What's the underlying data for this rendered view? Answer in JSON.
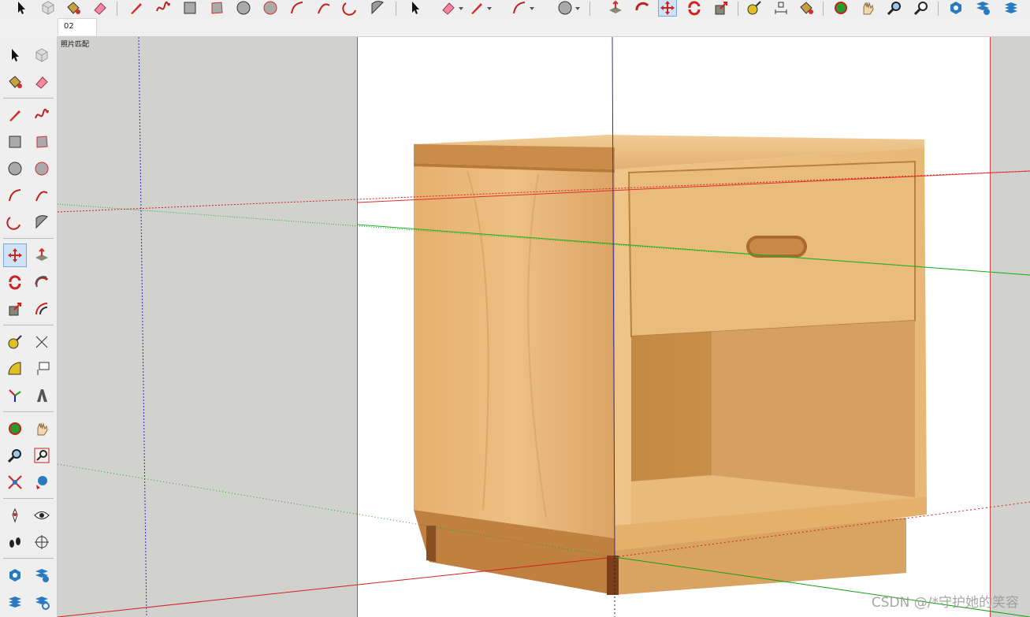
{
  "scene": {
    "tab_label": "02"
  },
  "viewport": {
    "label": "照片匹配",
    "mode": "match-photo"
  },
  "watermark": {
    "text": "CSDN @/*守护她的笑容"
  },
  "toolbar_top": {
    "icons": [
      "select-icon",
      "component-icon",
      "paint-bucket-icon",
      "eraser-icon",
      "pencil-icon",
      "freehand-icon",
      "rectangle-icon",
      "rotated-rectangle-icon",
      "circle-icon",
      "polygon-icon",
      "arc-icon",
      "two-point-arc-icon",
      "three-point-arc-icon",
      "pie-icon",
      "select-icon",
      "eraser-icon",
      "line-icon",
      "arc-icon",
      "circle-icon",
      "push-pull-icon",
      "follow-me-icon",
      "move-icon",
      "rotate-icon",
      "scale-icon",
      "tape-measure-icon",
      "dimension-icon",
      "paint-bucket-icon",
      "orbit-icon",
      "pan-icon",
      "zoom-icon",
      "zoom-window-icon",
      "warehouse-icon",
      "extension-warehouse-icon",
      "layers-icon"
    ],
    "active": "move-icon"
  },
  "toolbar_left": {
    "icons": [
      "select-icon",
      "make-component-icon",
      "paint-bucket-icon",
      "eraser-icon",
      "line-icon",
      "freehand-icon",
      "rectangle-icon",
      "rotated-rectangle-icon",
      "circle-icon",
      "polygon-icon",
      "arc-icon",
      "two-point-arc-icon",
      "three-point-arc-icon",
      "pie-icon",
      "move-icon",
      "push-pull-icon",
      "rotate-icon",
      "follow-me-icon",
      "scale-icon",
      "offset-icon",
      "tape-measure-icon",
      "dimension-icon",
      "protractor-icon",
      "text-icon",
      "axes-icon",
      "3d-text-icon",
      "orbit-icon",
      "pan-icon",
      "zoom-icon",
      "zoom-window-icon",
      "zoom-extents-icon",
      "previous-view-icon",
      "position-camera-icon",
      "look-around-icon",
      "walk-icon",
      "section-plane-icon",
      "warehouse-icon",
      "extension-warehouse-icon",
      "layers-icon",
      "extension-manager-icon"
    ],
    "active": "move-icon"
  },
  "colors": {
    "red_axis": "#d42020",
    "green_axis": "#1db01d",
    "blue_axis": "#2020c8",
    "frame": "#e04040",
    "wood_light": "#e9b877",
    "wood_mid": "#d9a060",
    "wood_dark": "#b87838",
    "active_tool": "#cfe3f7"
  }
}
